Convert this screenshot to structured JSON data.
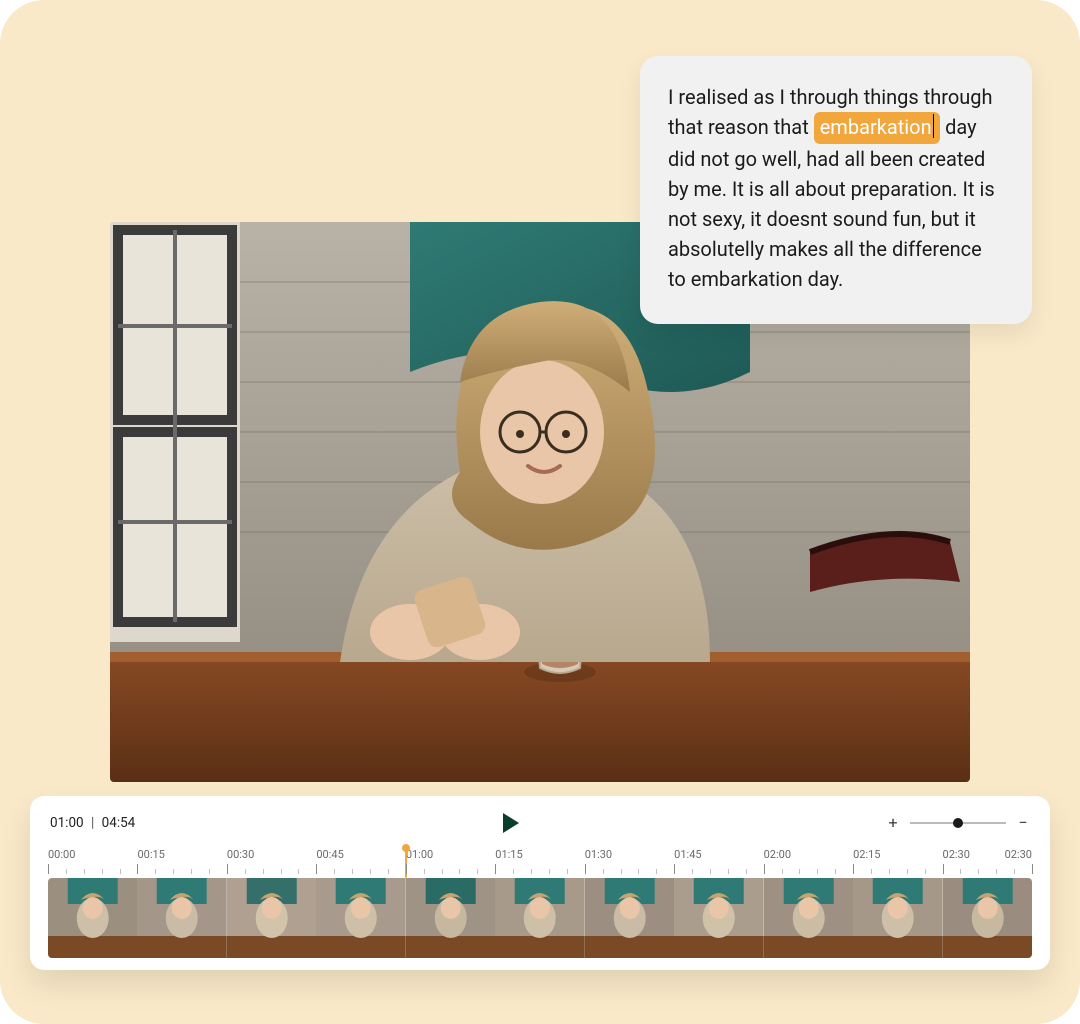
{
  "transcript": {
    "pre": "I realised as I through things through that reason that ",
    "highlight": "embarkation",
    "post": " day did not go well, had all been created by me. It is all about preparation. It is not sexy, it doesnt sound fun, but it absolutelly makes all the difference to embarkation day."
  },
  "player": {
    "current_time": "01:00",
    "duration": "04:54",
    "separator": "|",
    "zoom": {
      "plus": "+",
      "minus": "−",
      "value": 0.5
    },
    "playhead_fraction": 0.363
  },
  "ruler": {
    "labels": [
      "00:00",
      "00:15",
      "00:30",
      "00:45",
      "01:00",
      "01:15",
      "01:30",
      "01:45",
      "02:00",
      "02:15",
      "02:30",
      "02:30"
    ]
  },
  "thumbnails": {
    "count": 11
  },
  "colors": {
    "canvas_bg": "#f9e9c8",
    "highlight": "#f1a73c",
    "play_icon": "#0a3d2e"
  }
}
